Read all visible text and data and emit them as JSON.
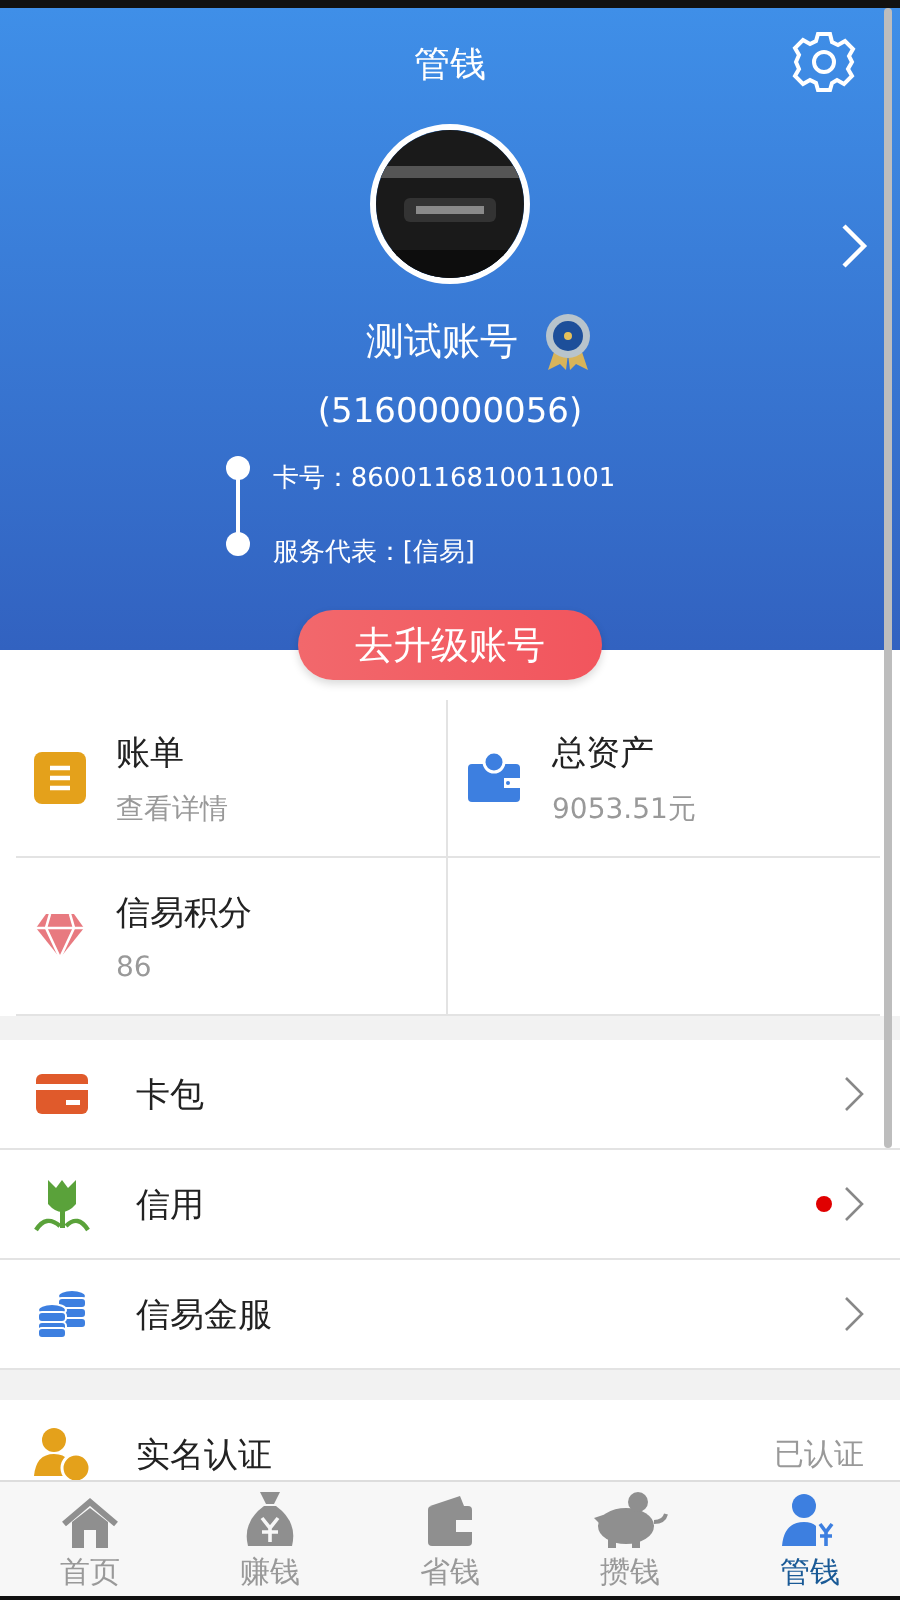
{
  "header": {
    "title": "管钱",
    "name": "测试账号",
    "account_id": "(51600000056)",
    "details": [
      "卡号：8600116810011001",
      "服务代表：[信易]"
    ],
    "upgrade_button": "去升级账号"
  },
  "tiles": [
    {
      "title": "账单",
      "subtitle": "查看详情"
    },
    {
      "title": "总资产",
      "subtitle": "9053.51元"
    },
    {
      "title": "信易积分",
      "subtitle": "86"
    }
  ],
  "menu": [
    {
      "label": "卡包",
      "notification_dot": false
    },
    {
      "label": "信用",
      "notification_dot": true
    },
    {
      "label": "信易金服",
      "notification_dot": false
    }
  ],
  "settings_rows": [
    {
      "label": "实名认证",
      "status": "已认证"
    }
  ],
  "tab_bar": [
    {
      "label": "首页",
      "selected": false
    },
    {
      "label": "赚钱",
      "selected": false
    },
    {
      "label": "省钱",
      "selected": false
    },
    {
      "label": "攒钱",
      "selected": false
    },
    {
      "label": "管钱",
      "selected": true
    }
  ]
}
